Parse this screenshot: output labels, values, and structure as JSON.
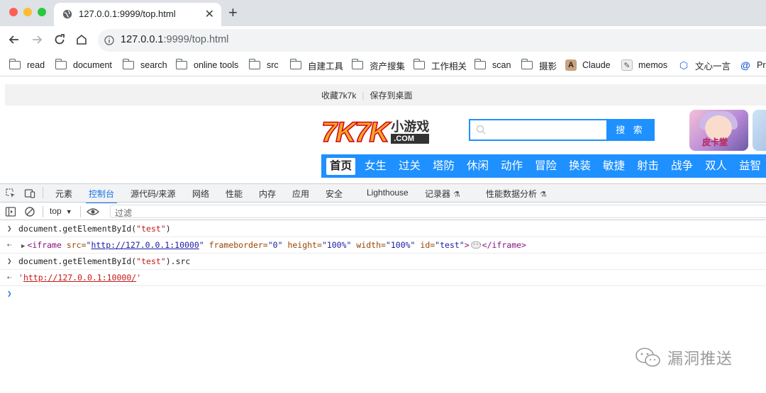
{
  "browser": {
    "tab_title": "127.0.0.1:9999/top.html",
    "url_host": "127.0.0.1",
    "url_rest": ":9999/top.html",
    "bookmarks": [
      "read",
      "document",
      "search",
      "online tools",
      "src",
      "自建工具",
      "资产搜集",
      "工作相关",
      "scan",
      "摄影",
      "Claude",
      "memos",
      "文心一言",
      "Pr"
    ]
  },
  "page": {
    "top_links": [
      "收藏7k7k",
      "保存到桌面"
    ],
    "logo_main": "7K7K",
    "logo_cn": "小游戏",
    "logo_com": ".COM",
    "search_button": "搜 索",
    "thumb_caption": "皮卡堂",
    "nav": [
      "首页",
      "女生",
      "过关",
      "塔防",
      "休闲",
      "动作",
      "冒险",
      "换装",
      "敏捷",
      "射击",
      "战争",
      "双人",
      "益智"
    ]
  },
  "devtools": {
    "tabs": [
      "元素",
      "控制台",
      "源代码/来源",
      "网络",
      "性能",
      "内存",
      "应用",
      "安全",
      "Lighthouse",
      "记录器",
      "性能数据分析"
    ],
    "active_tab": "控制台",
    "context": "top",
    "filter_placeholder": "过滤",
    "lines": {
      "l1_prefix": "document.getElementById(",
      "l1_str": "\"test\"",
      "l1_suffix": ")",
      "l2_open": "<iframe",
      "l2_src_attr": " src=",
      "l2_src_val": "http://127.0.0.1:10000",
      "l2_frame_attr": " frameborder=",
      "l2_frame_val": "\"0\"",
      "l2_h_attr": " height=",
      "l2_h_val": "\"100%\"",
      "l2_w_attr": " width=",
      "l2_w_val": "\"100%\"",
      "l2_id_attr": " id=",
      "l2_id_val": "\"test\"",
      "l2_close_gt": ">",
      "l2_close": "</iframe>",
      "l3_prefix": "document.getElementById(",
      "l3_str": "\"test\"",
      "l3_suffix": ").src",
      "l4_val": "http://127.0.0.1:10000/"
    }
  },
  "watermark": "漏洞推送"
}
